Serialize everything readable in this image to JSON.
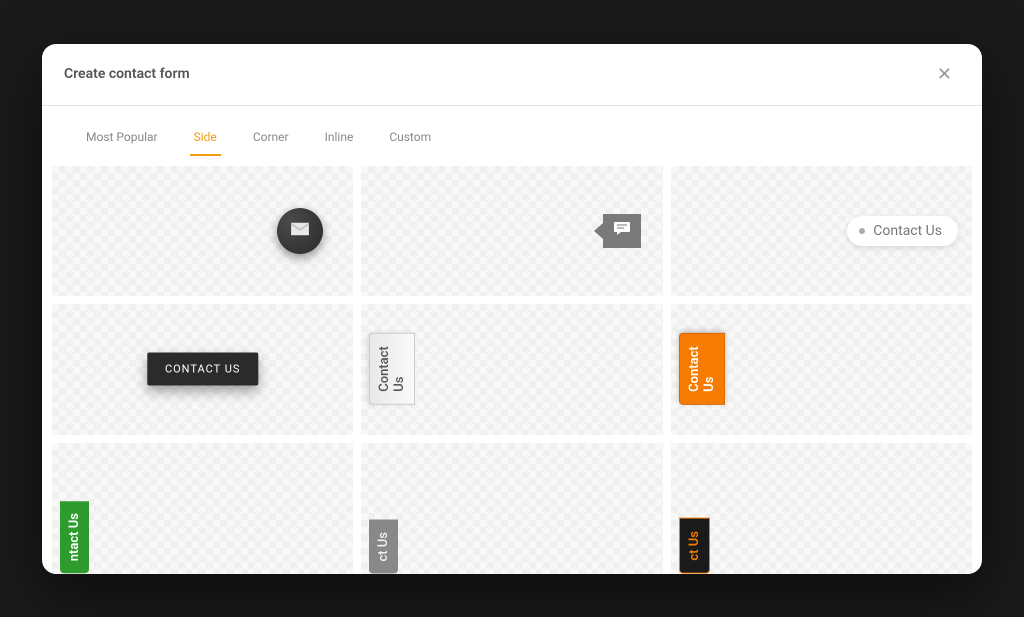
{
  "header": {
    "title": "Create contact form"
  },
  "tabs": [
    {
      "label": "Most Popular",
      "active": false
    },
    {
      "label": "Side",
      "active": true
    },
    {
      "label": "Corner",
      "active": false
    },
    {
      "label": "Inline",
      "active": false
    },
    {
      "label": "Custom",
      "active": false
    }
  ],
  "templates": {
    "t3_label": "Contact Us",
    "t4_label": "CONTACT US",
    "t5_label": "Contact Us",
    "t6_label": "Contact Us",
    "t7_label": "ntact Us",
    "t8_label": "ct Us",
    "t9_label": "ct Us"
  },
  "colors": {
    "accent": "#f39c12",
    "orange_tab": "#f57c00",
    "green_tab": "#2e9b2e"
  }
}
